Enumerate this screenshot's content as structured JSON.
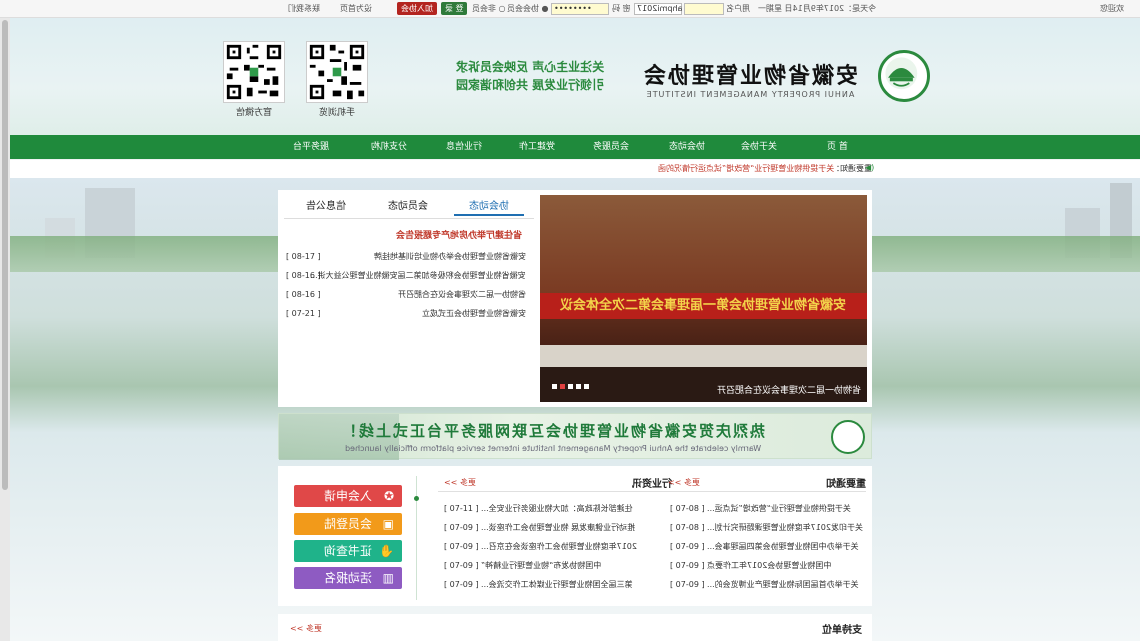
{
  "topbar": {
    "welcome": "欢迎您",
    "today": "今天是：2017年9月14日 星期一",
    "username_label": "用户名",
    "username_value": "ahpmi2017",
    "password_label": "密 码",
    "password_value": "••••••••",
    "radio_member": "协会会员",
    "radio_nonmember": "非会员",
    "login_button": "登 录",
    "join_button": "加入协会",
    "set_home": "设为首页",
    "contact": "联系我们"
  },
  "header": {
    "org_name": "安徽省物业管理协会",
    "org_name_en": "ANHUI PROPERTY MANAGEMENT INSTITUTE",
    "slogan_line1": "关注业主心声 反映会员诉求",
    "slogan_line2": "引领行业发展 共创和谐家园",
    "qr1_label": "官方微信",
    "qr2_label": "手机浏览"
  },
  "nav": {
    "items": [
      "首 页",
      "关于协会",
      "协会动态",
      "会员服务",
      "党建工作",
      "行业信息",
      "分支机构",
      "服务平台"
    ]
  },
  "notice": {
    "label": "重要通知：",
    "text": "关于提供物业管理行业“营改增”试点运行情况的函"
  },
  "news": {
    "tabs": [
      "协会动态",
      "会员动态",
      "信息公告"
    ],
    "headline": "省住建厅举办房地产专题报告会",
    "items": [
      {
        "title": "安徽省物业管理协会举办物业培训基地挂牌",
        "date": "[ 08-17 ]"
      },
      {
        "title": "安徽省物业管理协会积极参加第二届安徽物业管理公益大讲...",
        "date": "[ 08-16 ]"
      },
      {
        "title": "省物协一届二次理事会议在合肥召开",
        "date": "[ 08-16 ]"
      },
      {
        "title": "安徽省物业管理协会正式成立",
        "date": "[ 07-21 ]"
      }
    ]
  },
  "slideshow": {
    "banner_text": "安徽省物业管理协会第一届理事会第二次全体会议",
    "caption": "省物协一届二次理事会议在合肥召开"
  },
  "banner": {
    "text": "热烈庆贺安徽省物业管理协会互联网服务平台正式上线！",
    "text_en": "Warmly celebrate the Anhui Property Management Institute internet service platform officially launched"
  },
  "notices_section": {
    "title": "重要通知",
    "more": "更多 >>",
    "items": [
      {
        "title": "关于提供物业管理行业“营改增”试点运...",
        "date": "[ 07-08 ]"
      },
      {
        "title": "关于印发2017年度物业管理课题研究计划...",
        "date": "[ 07-08 ]"
      },
      {
        "title": "关于举办中国物业管理协会第四届理事会...",
        "date": "[ 07-09 ]"
      },
      {
        "title": "中国物业管理协会2017年工作要点",
        "date": "[ 07-09 ]"
      },
      {
        "title": "关于举办首届国际物业管理产业博览会的...",
        "date": "[ 07-09 ]"
      }
    ]
  },
  "industry_section": {
    "title": "行业资讯",
    "more": "更多 >>",
    "items": [
      {
        "title": "住建部长陈政高：加大物业服务行业安全...",
        "date": "[ 07-11 ]"
      },
      {
        "title": "推动行业健康发展 物业管理协会工作座谈...",
        "date": "[ 07-09 ]"
      },
      {
        "title": "2017年度物业管理协会工作座谈会在京召...",
        "date": "[ 07-09 ]"
      },
      {
        "title": "中国物协发布“物业管理行业精神”",
        "date": "[ 07-09 ]"
      },
      {
        "title": "第三届全国物业管理行业媒体工作交流会...",
        "date": "[ 07-09 ]"
      }
    ]
  },
  "side_buttons": [
    {
      "label": "入会申请",
      "color": "#e04848",
      "icon": "badge-icon"
    },
    {
      "label": "会员登陆",
      "color": "#f29a1a",
      "icon": "monitor-icon"
    },
    {
      "label": "证书查询",
      "color": "#1fb38a",
      "icon": "handshake-icon"
    },
    {
      "label": "活动报名",
      "color": "#8e5bc2",
      "icon": "chart-icon"
    }
  ],
  "support_section": {
    "title": "支持单位",
    "more": "更多 >>"
  },
  "colors": {
    "brand_green": "#1f8a3c",
    "accent_red": "#c0392b"
  }
}
